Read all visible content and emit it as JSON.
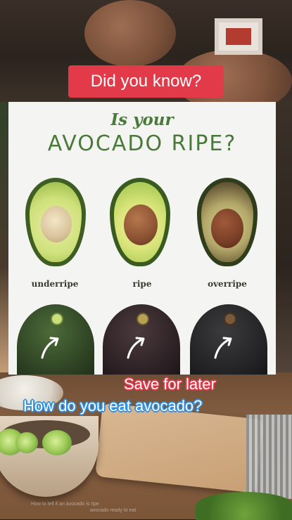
{
  "badge": {
    "label": "Did you know?"
  },
  "infographic": {
    "title_line_1": "Is your",
    "title_line_2": "AVOCADO RIPE?",
    "states": [
      {
        "label": "underripe"
      },
      {
        "label": "ripe"
      },
      {
        "label": "overripe"
      }
    ]
  },
  "overlay": {
    "save_text": "Save for later",
    "question_text": "How do you eat avocado?"
  },
  "caption": {
    "line_1": "How to tell if an avocado is ripe",
    "line_2": "avocado ready to eat"
  },
  "colors": {
    "badge_red": "#e33a4a",
    "title_green": "#4a7a3a",
    "question_blue": "#2f8fe0"
  }
}
